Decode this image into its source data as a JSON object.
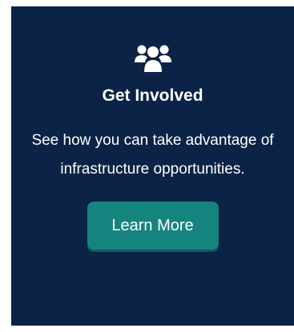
{
  "card": {
    "icon": "users-group-icon",
    "title": "Get Involved",
    "description": "See how you can take advantage of infrastructure opportunities.",
    "button_label": "Learn More"
  },
  "colors": {
    "card_background": "#0a2346",
    "button_background": "#16847e",
    "text": "#ffffff"
  }
}
